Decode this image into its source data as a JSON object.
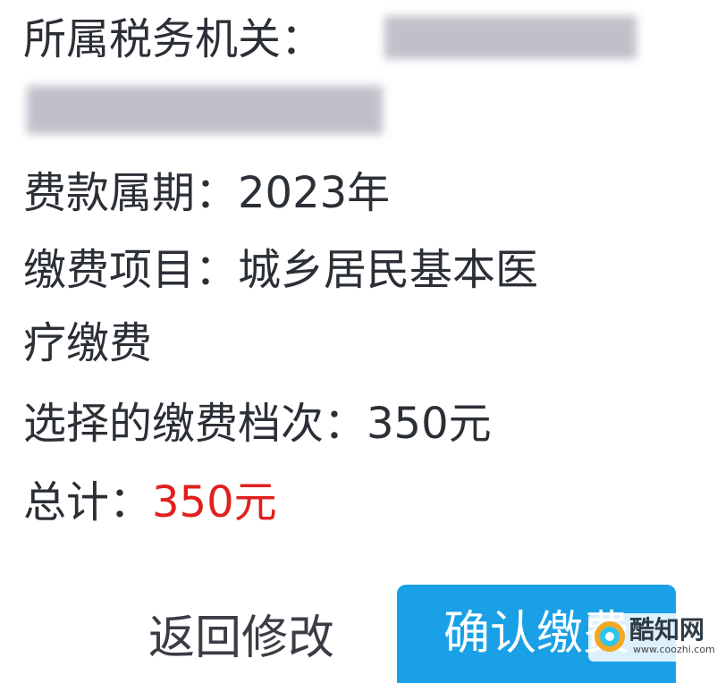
{
  "fields": {
    "tax_office_label": "所属税务机关：",
    "fee_period_label": "费款属期：",
    "fee_period_value": "2023年",
    "item_label": "缴费项目：",
    "item_value_line1": "城乡居民基本医",
    "item_value_line2": "疗缴费",
    "tier_label": "选择的缴费档次：",
    "tier_value": "350元",
    "total_label": "总计：",
    "total_value": "350元"
  },
  "buttons": {
    "back_label": "返回修改",
    "confirm_label": "确认缴费"
  },
  "watermark": {
    "text": "酷知网",
    "url": "www.coozhi.com"
  },
  "colors": {
    "text": "#2b2f36",
    "total_value": "#e0201e",
    "confirm_button": "#1aa0e6"
  }
}
